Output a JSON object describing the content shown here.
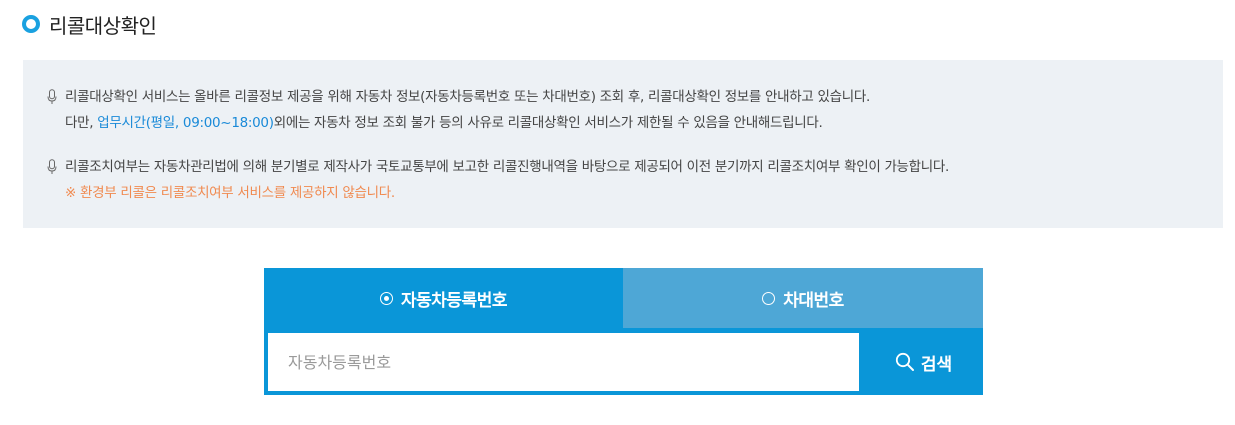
{
  "page": {
    "title": "리콜대상확인"
  },
  "notice": {
    "para1_line1": "리콜대상확인 서비스는 올바른 리콜정보 제공을 위해 자동차 정보(자동차등록번호 또는 차대번호) 조회 후, 리콜대상확인 정보를 안내하고 있습니다.",
    "para1_line2_prefix": "다만, ",
    "para1_line2_highlight": "업무시간(평일, 09:00~18:00)",
    "para1_line2_suffix": "외에는 자동차 정보 조회 불가 등의 사유로 리콜대상확인 서비스가 제한될 수 있음을 안내해드립니다.",
    "para2_line1": "리콜조치여부는 자동차관리법에 의해 분기별로 제작사가 국토교통부에 보고한 리콜진행내역을 바탕으로 제공되어 이전 분기까지 리콜조치여부 확인이 가능합니다.",
    "para2_line2": "※ 환경부 리콜은 리콜조치여부 서비스를 제공하지 않습니다."
  },
  "search": {
    "tabs": [
      {
        "label": "자동차등록번호",
        "selected": true
      },
      {
        "label": "차대번호",
        "selected": false
      }
    ],
    "input_placeholder": "자동차등록번호",
    "input_value": "",
    "button_label": "검색"
  },
  "colors": {
    "accent": "#0a96d8",
    "tab_inactive": "#4ea7d6",
    "info_bg": "#edf1f5",
    "highlight": "#1a8ad8",
    "warning": "#f08a50"
  },
  "icons": [
    "circle-bullet-icon",
    "microphone-icon",
    "radio-selected-icon",
    "radio-unselected-icon",
    "search-icon"
  ]
}
